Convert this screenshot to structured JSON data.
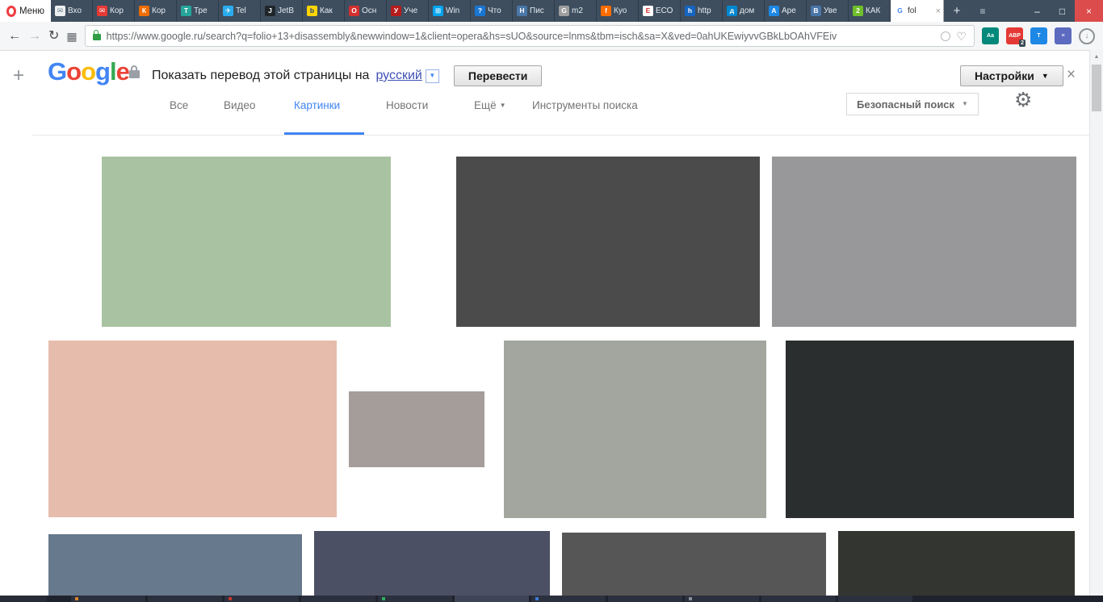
{
  "window": {
    "menu_label": "Меню",
    "new_tab": "+",
    "tab_menu": "≡",
    "minimize": "–",
    "maximize": "□",
    "close": "×"
  },
  "tabs": [
    {
      "label": "Вхо",
      "fav": {
        "glyph": "✉",
        "bg": "#eceff1",
        "fg": "#607d8b"
      }
    },
    {
      "label": "Кор",
      "fav": {
        "glyph": "✉",
        "bg": "#e53935",
        "fg": "#ffffff"
      }
    },
    {
      "label": "Кор",
      "fav": {
        "glyph": "К",
        "bg": "#ef6c00",
        "fg": "#ffffff"
      }
    },
    {
      "label": "Тре",
      "fav": {
        "glyph": "Т",
        "bg": "#26a69a",
        "fg": "#ffffff"
      }
    },
    {
      "label": "Tel",
      "fav": {
        "glyph": "✈",
        "bg": "#2aabee",
        "fg": "#ffffff"
      }
    },
    {
      "label": "JetB",
      "fav": {
        "glyph": "J",
        "bg": "#21262b",
        "fg": "#ffffff"
      }
    },
    {
      "label": "Как",
      "fav": {
        "glyph": "b",
        "bg": "#ffd500",
        "fg": "#1a3e8c"
      }
    },
    {
      "label": "Осн",
      "fav": {
        "glyph": "О",
        "bg": "#d32f2f",
        "fg": "#ffffff"
      }
    },
    {
      "label": "Уче",
      "fav": {
        "glyph": "У",
        "bg": "#b71c1c",
        "fg": "#ffffff"
      }
    },
    {
      "label": "Win",
      "fav": {
        "glyph": "⊞",
        "bg": "#00a4ef",
        "fg": "#ffffff"
      }
    },
    {
      "label": "Что",
      "fav": {
        "glyph": "?",
        "bg": "#1976d2",
        "fg": "#ffffff"
      }
    },
    {
      "label": "Пис",
      "fav": {
        "glyph": "Н",
        "bg": "#4a76a8",
        "fg": "#ffffff"
      }
    },
    {
      "label": "m2",
      "fav": {
        "glyph": "G",
        "bg": "#9e9e9e",
        "fg": "#ffffff"
      }
    },
    {
      "label": "Куо",
      "fav": {
        "glyph": "f",
        "bg": "#ff6d00",
        "fg": "#ffffff"
      }
    },
    {
      "label": "ЕСО",
      "fav": {
        "glyph": "Е",
        "bg": "#ffffff",
        "fg": "#d32f2f"
      }
    },
    {
      "label": "http",
      "fav": {
        "glyph": "h",
        "bg": "#1565c0",
        "fg": "#ffffff"
      }
    },
    {
      "label": "дом",
      "fav": {
        "glyph": "д",
        "bg": "#0288d1",
        "fg": "#ffffff"
      }
    },
    {
      "label": "Аре",
      "fav": {
        "glyph": "А",
        "bg": "#1e88e5",
        "fg": "#ffffff"
      }
    },
    {
      "label": "Уве",
      "fav": {
        "glyph": "В",
        "bg": "#4a76a8",
        "fg": "#ffffff"
      }
    },
    {
      "label": "КАК",
      "fav": {
        "glyph": "2",
        "bg": "#6fbf2a",
        "fg": "#ffffff"
      }
    },
    {
      "label": "fol",
      "active": true,
      "close": "×",
      "fav": {
        "glyph": "G",
        "bg": "#ffffff",
        "fg": "#4285f4"
      }
    }
  ],
  "toolbar": {
    "back": "←",
    "forward": "→",
    "reload": "↻",
    "speed_dial": "▦",
    "url": "https://www.google.ru/search?q=folio+13+disassembly&newwindow=1&client=opera&hs=sUO&source=lnms&tbm=isch&sa=X&ved=0ahUKEwiyvvGBkLbOAhVFEiv",
    "heart": "♡",
    "download": "↓"
  },
  "extensions": [
    {
      "glyph": "Aa",
      "bg": "#00897b"
    },
    {
      "glyph": "ABP",
      "bg": "#e53935",
      "badge": "2"
    },
    {
      "glyph": "Т",
      "bg": "#1e88e5"
    },
    {
      "glyph": "≡",
      "bg": "#5c6bc0"
    }
  ],
  "sidebar": {
    "plus": "+"
  },
  "translate_bar": {
    "logo": [
      {
        "ch": "G",
        "color": "#4285F4"
      },
      {
        "ch": "o",
        "color": "#EA4335"
      },
      {
        "ch": "o",
        "color": "#FBBC05"
      },
      {
        "ch": "g",
        "color": "#4285F4"
      },
      {
        "ch": "l",
        "color": "#34A853"
      },
      {
        "ch": "e",
        "color": "#EA4335"
      }
    ],
    "message": "Показать перевод этой страницы на",
    "language": "русский",
    "language_caret": "▼",
    "translate_button": "Перевести",
    "settings_button": "Настройки",
    "settings_caret": "▼",
    "close": "×"
  },
  "search_nav": {
    "items": [
      "Все",
      "Видео",
      "Картинки",
      "Новости",
      "Ещё",
      "Инструменты поиска"
    ],
    "more_caret": "▼",
    "active": "Картинки",
    "accent_color": "#4285f4",
    "safe_search": "Безопасный поиск",
    "safe_search_caret": "▼",
    "gear": "⚙"
  },
  "results": [
    {
      "color": "#a9c3a2"
    },
    {
      "color": "#4b4b4b"
    },
    {
      "color": "#98989a"
    },
    {
      "color": "#e6bcac"
    },
    {
      "color": "#a49d99"
    },
    {
      "color": "#a2a69e"
    },
    {
      "color": "#2b2e2e"
    },
    {
      "color": "#67798c"
    },
    {
      "color": "#4c5064"
    },
    {
      "color": "#565656"
    },
    {
      "color": "#333530"
    }
  ],
  "scrollbar": {
    "up": "▲"
  }
}
